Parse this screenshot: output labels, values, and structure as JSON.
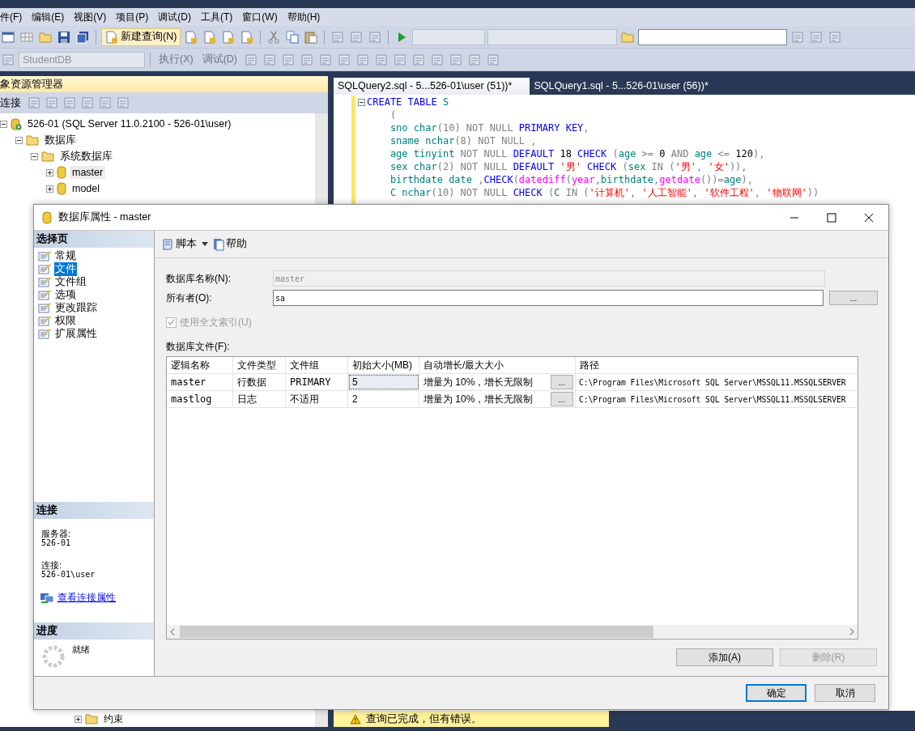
{
  "menu": [
    {
      "label": "件(F)"
    },
    {
      "label": "编辑(E)"
    },
    {
      "label": "视图(V)"
    },
    {
      "label": "项目(P)"
    },
    {
      "label": "调试(D)"
    },
    {
      "label": "工具(T)"
    },
    {
      "label": "窗口(W)"
    },
    {
      "label": "帮助(H)"
    }
  ],
  "toolbar": {
    "new_query": "新建查询(N)",
    "database": "StudentDB",
    "execute": "执行(X)",
    "debug": "调试(D)"
  },
  "object_explorer": {
    "title": "象资源管理器",
    "connect": "连接",
    "tree": [
      {
        "label": "526-01 (SQL Server 11.0.2100 - 526-01\\user)",
        "kind": "server",
        "expanded": true,
        "selected": false,
        "children": [
          {
            "label": "数据库",
            "kind": "folder",
            "expanded": true,
            "selected": false,
            "children": [
              {
                "label": "系统数据库",
                "kind": "folder",
                "expanded": true,
                "selected": false,
                "children": [
                  {
                    "label": "master",
                    "kind": "database",
                    "expanded": false,
                    "selected": true
                  },
                  {
                    "label": "model",
                    "kind": "database",
                    "expanded": false,
                    "selected": false
                  }
                ]
              }
            ]
          }
        ]
      }
    ],
    "tail_item": {
      "label": "约束",
      "kind": "folder",
      "expanded": false
    }
  },
  "editor": {
    "tabs": [
      {
        "label": "SQLQuery2.sql - 5...526-01\\user (51))*",
        "selected": true
      },
      {
        "label": "SQLQuery1.sql - 5...526-01\\user (56))*",
        "selected": false
      }
    ],
    "code": [
      [
        {
          "kind": "kw",
          "text": "CREATE TABLE"
        },
        {
          "kind": "id",
          "text": " S"
        }
      ],
      [
        {
          "kind": "op",
          "text": "    ("
        }
      ],
      [
        {
          "kind": "id",
          "text": "    sno char"
        },
        {
          "kind": "op",
          "text": "(10) NOT NULL "
        },
        {
          "kind": "kw",
          "text": "PRIMARY KEY"
        },
        {
          "kind": "op",
          "text": ","
        }
      ],
      [
        {
          "kind": "id",
          "text": "    sname nchar"
        },
        {
          "kind": "op",
          "text": "(8) NOT NULL ,"
        }
      ],
      [
        {
          "kind": "id",
          "text": "    age tinyint"
        },
        {
          "kind": "op",
          "text": " NOT NULL "
        },
        {
          "kind": "kw",
          "text": "DEFAULT"
        },
        {
          "kind": "num",
          "text": " 18 "
        },
        {
          "kind": "kw",
          "text": "CHECK"
        },
        {
          "kind": "op",
          "text": " ("
        },
        {
          "kind": "id",
          "text": "age"
        },
        {
          "kind": "op",
          "text": " >= "
        },
        {
          "kind": "num",
          "text": "0"
        },
        {
          "kind": "op",
          "text": " AND "
        },
        {
          "kind": "id",
          "text": "age"
        },
        {
          "kind": "op",
          "text": " <= "
        },
        {
          "kind": "num",
          "text": "120"
        },
        {
          "kind": "op",
          "text": "),"
        }
      ],
      [
        {
          "kind": "id",
          "text": "    sex char"
        },
        {
          "kind": "op",
          "text": "(2) NOT NULL "
        },
        {
          "kind": "kw",
          "text": "DEFAULT"
        },
        {
          "kind": "str",
          "text": " '男'"
        },
        {
          "kind": "kw",
          "text": " CHECK"
        },
        {
          "kind": "op",
          "text": " ("
        },
        {
          "kind": "id",
          "text": "sex"
        },
        {
          "kind": "op",
          "text": " IN ("
        },
        {
          "kind": "str",
          "text": "'男'"
        },
        {
          "kind": "op",
          "text": ", "
        },
        {
          "kind": "str",
          "text": "'女'"
        },
        {
          "kind": "op",
          "text": ")),"
        }
      ],
      [
        {
          "kind": "id",
          "text": "    birthdate date"
        },
        {
          "kind": "op",
          "text": " ,"
        },
        {
          "kind": "kw",
          "text": "CHECK"
        },
        {
          "kind": "op",
          "text": "("
        },
        {
          "kind": "fn",
          "text": "datediff"
        },
        {
          "kind": "op",
          "text": "("
        },
        {
          "kind": "fn",
          "text": "year"
        },
        {
          "kind": "op",
          "text": ","
        },
        {
          "kind": "id",
          "text": "birthdate"
        },
        {
          "kind": "op",
          "text": ","
        },
        {
          "kind": "fn",
          "text": "getdate"
        },
        {
          "kind": "op",
          "text": "())="
        },
        {
          "kind": "id",
          "text": "age"
        },
        {
          "kind": "op",
          "text": "),"
        }
      ],
      [
        {
          "kind": "id",
          "text": "    C nchar"
        },
        {
          "kind": "op",
          "text": "(10) NOT NULL "
        },
        {
          "kind": "kw",
          "text": "CHECK"
        },
        {
          "kind": "op",
          "text": " ("
        },
        {
          "kind": "id",
          "text": "C"
        },
        {
          "kind": "op",
          "text": " IN ("
        },
        {
          "kind": "str",
          "text": "'计算机'"
        },
        {
          "kind": "op",
          "text": ", "
        },
        {
          "kind": "str",
          "text": "'人工智能'"
        },
        {
          "kind": "op",
          "text": ", "
        },
        {
          "kind": "str",
          "text": "'软件工程'"
        },
        {
          "kind": "op",
          "text": ", "
        },
        {
          "kind": "str",
          "text": "'物联网'"
        },
        {
          "kind": "op",
          "text": "))"
        }
      ]
    ],
    "status": "查询已完成，但有错误。"
  },
  "dialog": {
    "title": "数据库属性 - master",
    "pages_header": "选择页",
    "pages": [
      {
        "label": "常规",
        "selected": false
      },
      {
        "label": "文件",
        "selected": true
      },
      {
        "label": "文件组",
        "selected": false
      },
      {
        "label": "选项",
        "selected": false
      },
      {
        "label": "更改跟踪",
        "selected": false
      },
      {
        "label": "权限",
        "selected": false
      },
      {
        "label": "扩展属性",
        "selected": false
      }
    ],
    "connection": {
      "header": "连接",
      "server_label": "服务器:",
      "server": "526-01",
      "connection_label": "连接:",
      "connection": "526-01\\user",
      "link": "查看连接属性"
    },
    "progress": {
      "header": "进度",
      "status": "就绪"
    },
    "script_button": "脚本",
    "help_button": "帮助",
    "db_name": {
      "label": "数据库名称(N):",
      "value": "master",
      "disabled": true
    },
    "owner": {
      "label": "所有者(O):",
      "value": "sa",
      "disabled": false,
      "browse": "..."
    },
    "fulltext": {
      "label": "使用全文索引(U)",
      "checked": true,
      "disabled": true
    },
    "files_label": "数据库文件(F):",
    "columns": [
      "逻辑名称",
      "文件类型",
      "文件组",
      "初始大小(MB)",
      "自动增长/最大大小",
      "路径"
    ],
    "rows": [
      {
        "name": "master",
        "type": "行数据",
        "filegroup": "PRIMARY",
        "size": "5",
        "autogrow": "增量为 10%，增长无限制",
        "browse": "...",
        "path": "C:\\Program Files\\Microsoft SQL Server\\MSSQL11.MSSQLSERVER",
        "focused": true
      },
      {
        "name": "mastlog",
        "type": "日志",
        "filegroup": "不适用",
        "size": "2",
        "autogrow": "增量为 10%，增长无限制",
        "browse": "...",
        "path": "C:\\Program Files\\Microsoft SQL Server\\MSSQL11.MSSQLSERVER",
        "focused": false
      }
    ],
    "add_button": {
      "label": "添加(A)",
      "disabled": false
    },
    "remove_button": {
      "label": "删除(R)",
      "disabled": true
    },
    "ok_button": "确定",
    "cancel_button": "取消"
  }
}
